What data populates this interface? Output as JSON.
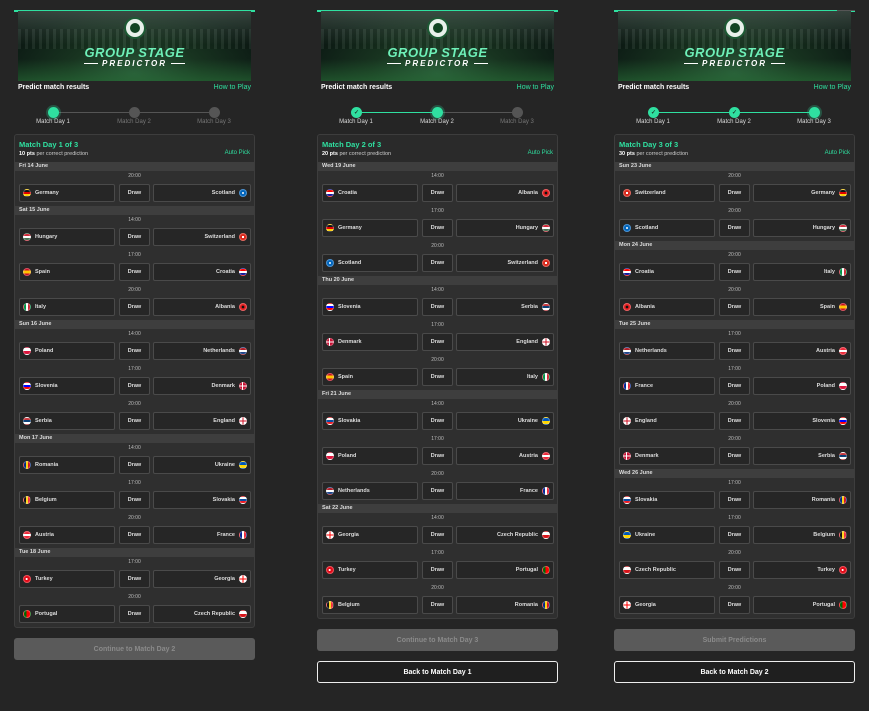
{
  "header": {
    "title_line1": "GROUP STAGE",
    "title_line2": "PREDICTOR",
    "subtitle": "Predict match results",
    "how_to_play": "How to Play"
  },
  "steps": [
    "Match Day 1",
    "Match Day 2",
    "Match Day 3"
  ],
  "draw_label": "Draw",
  "auto_pick": "Auto Pick",
  "pts_suffix": "per correct prediction",
  "colors": {
    "accent": "#2fe0a0",
    "panel": "#2f2f2f",
    "background": "#252525"
  },
  "columns": [
    {
      "current_step": 0,
      "match_day_title": "Match Day 1 of 3",
      "points": "10 pts",
      "primary_button": "Continue to Match Day 2",
      "secondary_button": "",
      "days": [
        {
          "date": "Fri 14 June",
          "matches": [
            {
              "time": "20:00",
              "home": "Germany",
              "home_flag": "de",
              "away": "Scotland",
              "away_flag": "sco"
            }
          ]
        },
        {
          "date": "Sat 15 June",
          "matches": [
            {
              "time": "14:00",
              "home": "Hungary",
              "home_flag": "hu",
              "away": "Switzerland",
              "away_flag": "ch"
            },
            {
              "time": "17:00",
              "home": "Spain",
              "home_flag": "es",
              "away": "Croatia",
              "away_flag": "hr"
            },
            {
              "time": "20:00",
              "home": "Italy",
              "home_flag": "it",
              "away": "Albania",
              "away_flag": "al"
            }
          ]
        },
        {
          "date": "Sun 16 June",
          "matches": [
            {
              "time": "14:00",
              "home": "Poland",
              "home_flag": "pl",
              "away": "Netherlands",
              "away_flag": "nl"
            },
            {
              "time": "17:00",
              "home": "Slovenia",
              "home_flag": "si",
              "away": "Denmark",
              "away_flag": "dk"
            },
            {
              "time": "20:00",
              "home": "Serbia",
              "home_flag": "rs",
              "away": "England",
              "away_flag": "en"
            }
          ]
        },
        {
          "date": "Mon 17 June",
          "matches": [
            {
              "time": "14:00",
              "home": "Romania",
              "home_flag": "ro",
              "away": "Ukraine",
              "away_flag": "ua"
            },
            {
              "time": "17:00",
              "home": "Belgium",
              "home_flag": "be",
              "away": "Slovakia",
              "away_flag": "sk"
            },
            {
              "time": "20:00",
              "home": "Austria",
              "home_flag": "at",
              "away": "France",
              "away_flag": "fr"
            }
          ]
        },
        {
          "date": "Tue 18 June",
          "matches": [
            {
              "time": "17:00",
              "home": "Turkey",
              "home_flag": "tr",
              "away": "Georgia",
              "away_flag": "ge"
            },
            {
              "time": "20:00",
              "home": "Portugal",
              "home_flag": "pt",
              "away": "Czech Republic",
              "away_flag": "cz"
            }
          ]
        }
      ]
    },
    {
      "current_step": 1,
      "match_day_title": "Match Day 2 of 3",
      "points": "20 pts",
      "primary_button": "Continue to Match Day 3",
      "secondary_button": "Back to Match Day 1",
      "days": [
        {
          "date": "Wed 19 June",
          "matches": [
            {
              "time": "14:00",
              "home": "Croatia",
              "home_flag": "hr",
              "away": "Albania",
              "away_flag": "al"
            },
            {
              "time": "17:00",
              "home": "Germany",
              "home_flag": "de",
              "away": "Hungary",
              "away_flag": "hu"
            },
            {
              "time": "20:00",
              "home": "Scotland",
              "home_flag": "sco",
              "away": "Switzerland",
              "away_flag": "ch"
            }
          ]
        },
        {
          "date": "Thu 20 June",
          "matches": [
            {
              "time": "14:00",
              "home": "Slovenia",
              "home_flag": "si",
              "away": "Serbia",
              "away_flag": "rs"
            },
            {
              "time": "17:00",
              "home": "Denmark",
              "home_flag": "dk",
              "away": "England",
              "away_flag": "en"
            },
            {
              "time": "20:00",
              "home": "Spain",
              "home_flag": "es",
              "away": "Italy",
              "away_flag": "it"
            }
          ]
        },
        {
          "date": "Fri 21 June",
          "matches": [
            {
              "time": "14:00",
              "home": "Slovakia",
              "home_flag": "sk",
              "away": "Ukraine",
              "away_flag": "ua"
            },
            {
              "time": "17:00",
              "home": "Poland",
              "home_flag": "pl",
              "away": "Austria",
              "away_flag": "at"
            },
            {
              "time": "20:00",
              "home": "Netherlands",
              "home_flag": "nl",
              "away": "France",
              "away_flag": "fr"
            }
          ]
        },
        {
          "date": "Sat 22 June",
          "matches": [
            {
              "time": "14:00",
              "home": "Georgia",
              "home_flag": "ge",
              "away": "Czech Republic",
              "away_flag": "cz"
            },
            {
              "time": "17:00",
              "home": "Turkey",
              "home_flag": "tr",
              "away": "Portugal",
              "away_flag": "pt"
            },
            {
              "time": "20:00",
              "home": "Belgium",
              "home_flag": "be",
              "away": "Romania",
              "away_flag": "ro"
            }
          ]
        }
      ]
    },
    {
      "current_step": 2,
      "match_day_title": "Match Day 3 of 3",
      "points": "30 pts",
      "primary_button": "Submit Predictions",
      "secondary_button": "Back to Match Day 2",
      "days": [
        {
          "date": "Sun 23 June",
          "matches": [
            {
              "time": "20:00",
              "home": "Switzerland",
              "home_flag": "ch",
              "away": "Germany",
              "away_flag": "de"
            },
            {
              "time": "20:00",
              "home": "Scotland",
              "home_flag": "sco",
              "away": "Hungary",
              "away_flag": "hu"
            }
          ]
        },
        {
          "date": "Mon 24 June",
          "matches": [
            {
              "time": "20:00",
              "home": "Croatia",
              "home_flag": "hr",
              "away": "Italy",
              "away_flag": "it"
            },
            {
              "time": "20:00",
              "home": "Albania",
              "home_flag": "al",
              "away": "Spain",
              "away_flag": "es"
            }
          ]
        },
        {
          "date": "Tue 25 June",
          "matches": [
            {
              "time": "17:00",
              "home": "Netherlands",
              "home_flag": "nl",
              "away": "Austria",
              "away_flag": "at"
            },
            {
              "time": "17:00",
              "home": "France",
              "home_flag": "fr",
              "away": "Poland",
              "away_flag": "pl"
            },
            {
              "time": "20:00",
              "home": "England",
              "home_flag": "en",
              "away": "Slovenia",
              "away_flag": "si"
            },
            {
              "time": "20:00",
              "home": "Denmark",
              "home_flag": "dk",
              "away": "Serbia",
              "away_flag": "rs"
            }
          ]
        },
        {
          "date": "Wed 26 June",
          "matches": [
            {
              "time": "17:00",
              "home": "Slovakia",
              "home_flag": "sk",
              "away": "Romania",
              "away_flag": "ro"
            },
            {
              "time": "17:00",
              "home": "Ukraine",
              "home_flag": "ua",
              "away": "Belgium",
              "away_flag": "be"
            },
            {
              "time": "20:00",
              "home": "Czech Republic",
              "home_flag": "cz",
              "away": "Turkey",
              "away_flag": "tr"
            },
            {
              "time": "20:00",
              "home": "Georgia",
              "home_flag": "ge",
              "away": "Portugal",
              "away_flag": "pt"
            }
          ]
        }
      ]
    }
  ]
}
